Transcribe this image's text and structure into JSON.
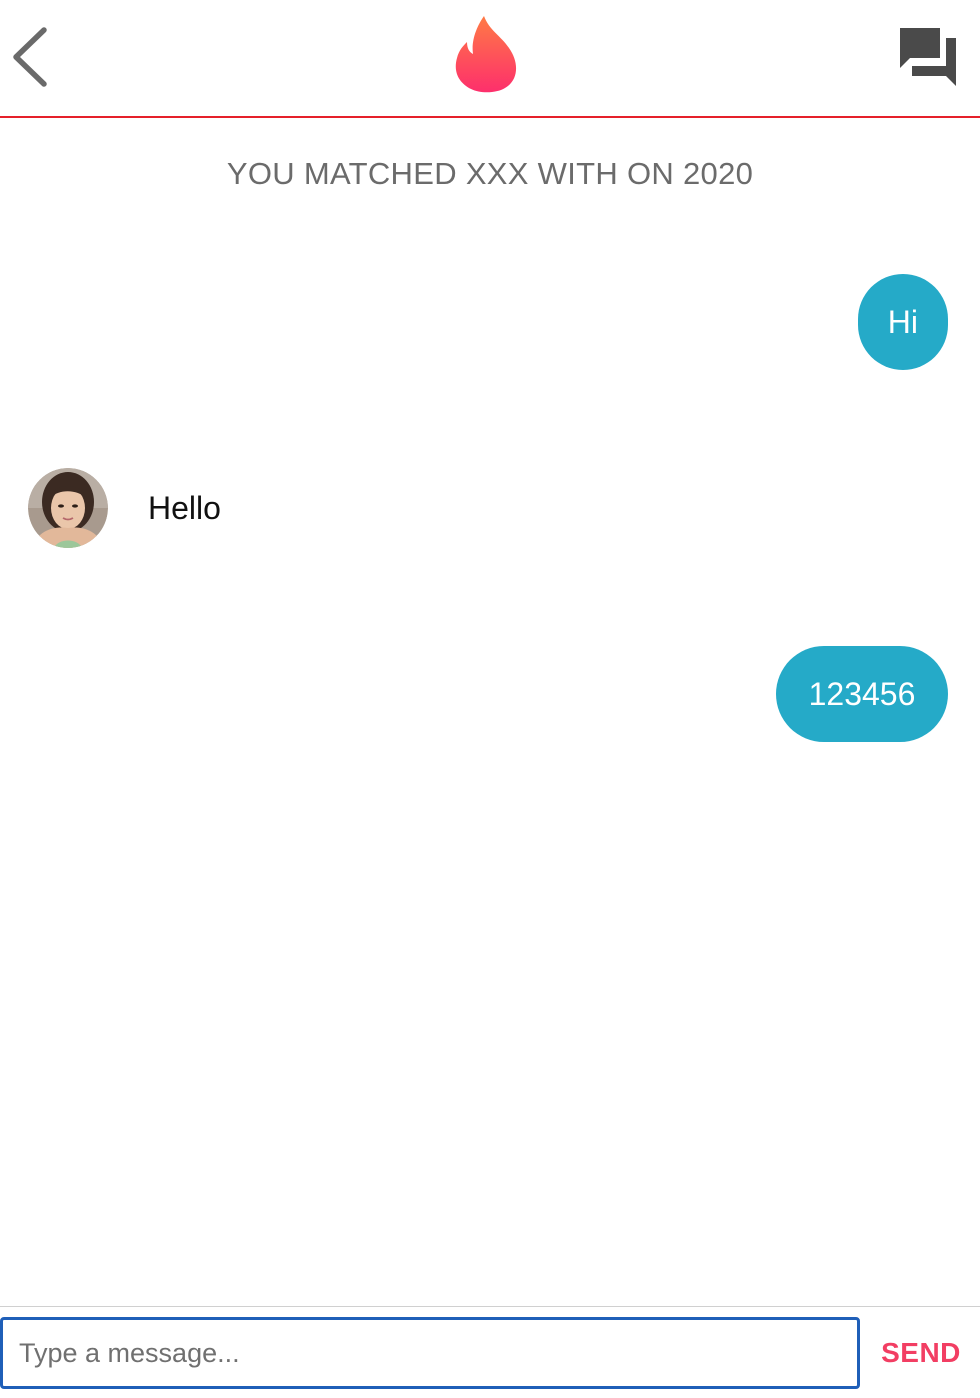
{
  "header": {
    "back_icon": "chevron-left-icon",
    "logo_icon": "flame-logo-icon",
    "chat_icon": "forum-icon"
  },
  "colors": {
    "header_border": "#e5202a",
    "bubble_out": "#25aac8",
    "send_button": "#f23e63",
    "input_border": "#1f5fb8",
    "flame_top": "#ff7a45",
    "flame_bottom": "#fd2f6c"
  },
  "conversation": {
    "match_banner": "YOU MATCHED XXX WITH ON 2020",
    "messages": [
      {
        "direction": "outgoing",
        "text": "Hi"
      },
      {
        "direction": "incoming",
        "text": "Hello",
        "has_avatar": true
      },
      {
        "direction": "outgoing",
        "text": "123456"
      }
    ]
  },
  "composer": {
    "input_value": "",
    "input_placeholder": "Type a message...",
    "send_label": "SEND"
  }
}
